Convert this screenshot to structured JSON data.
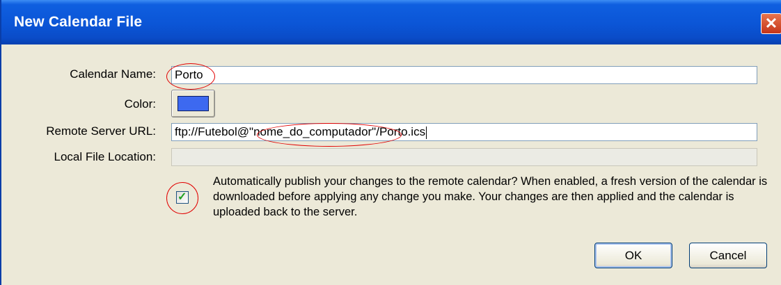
{
  "window": {
    "title": "New Calendar File",
    "close_glyph": "✕"
  },
  "form": {
    "calendar_name_label": "Calendar Name:",
    "calendar_name_value": "Porto",
    "color_label": "Color:",
    "color_value": "#3d69f0",
    "remote_url_label": "Remote Server URL:",
    "remote_url_value": "ftp://Futebol@\"nome_do_computador\"/Porto.ics",
    "local_file_label": "Local File Location:",
    "local_file_value": "",
    "auto_publish_checked": true,
    "auto_publish_check_glyph": "✓",
    "auto_publish_text": "Automatically publish your changes to the remote calendar? When enabled, a fresh version of the calendar is downloaded before applying any change you make. Your changes are then applied and the calendar is uploaded back to the server."
  },
  "buttons": {
    "ok": "OK",
    "cancel": "Cancel"
  },
  "colors": {
    "titlebar": "#0b55d6",
    "dialog_bg": "#ece9d8",
    "annotation": "#e10000"
  }
}
